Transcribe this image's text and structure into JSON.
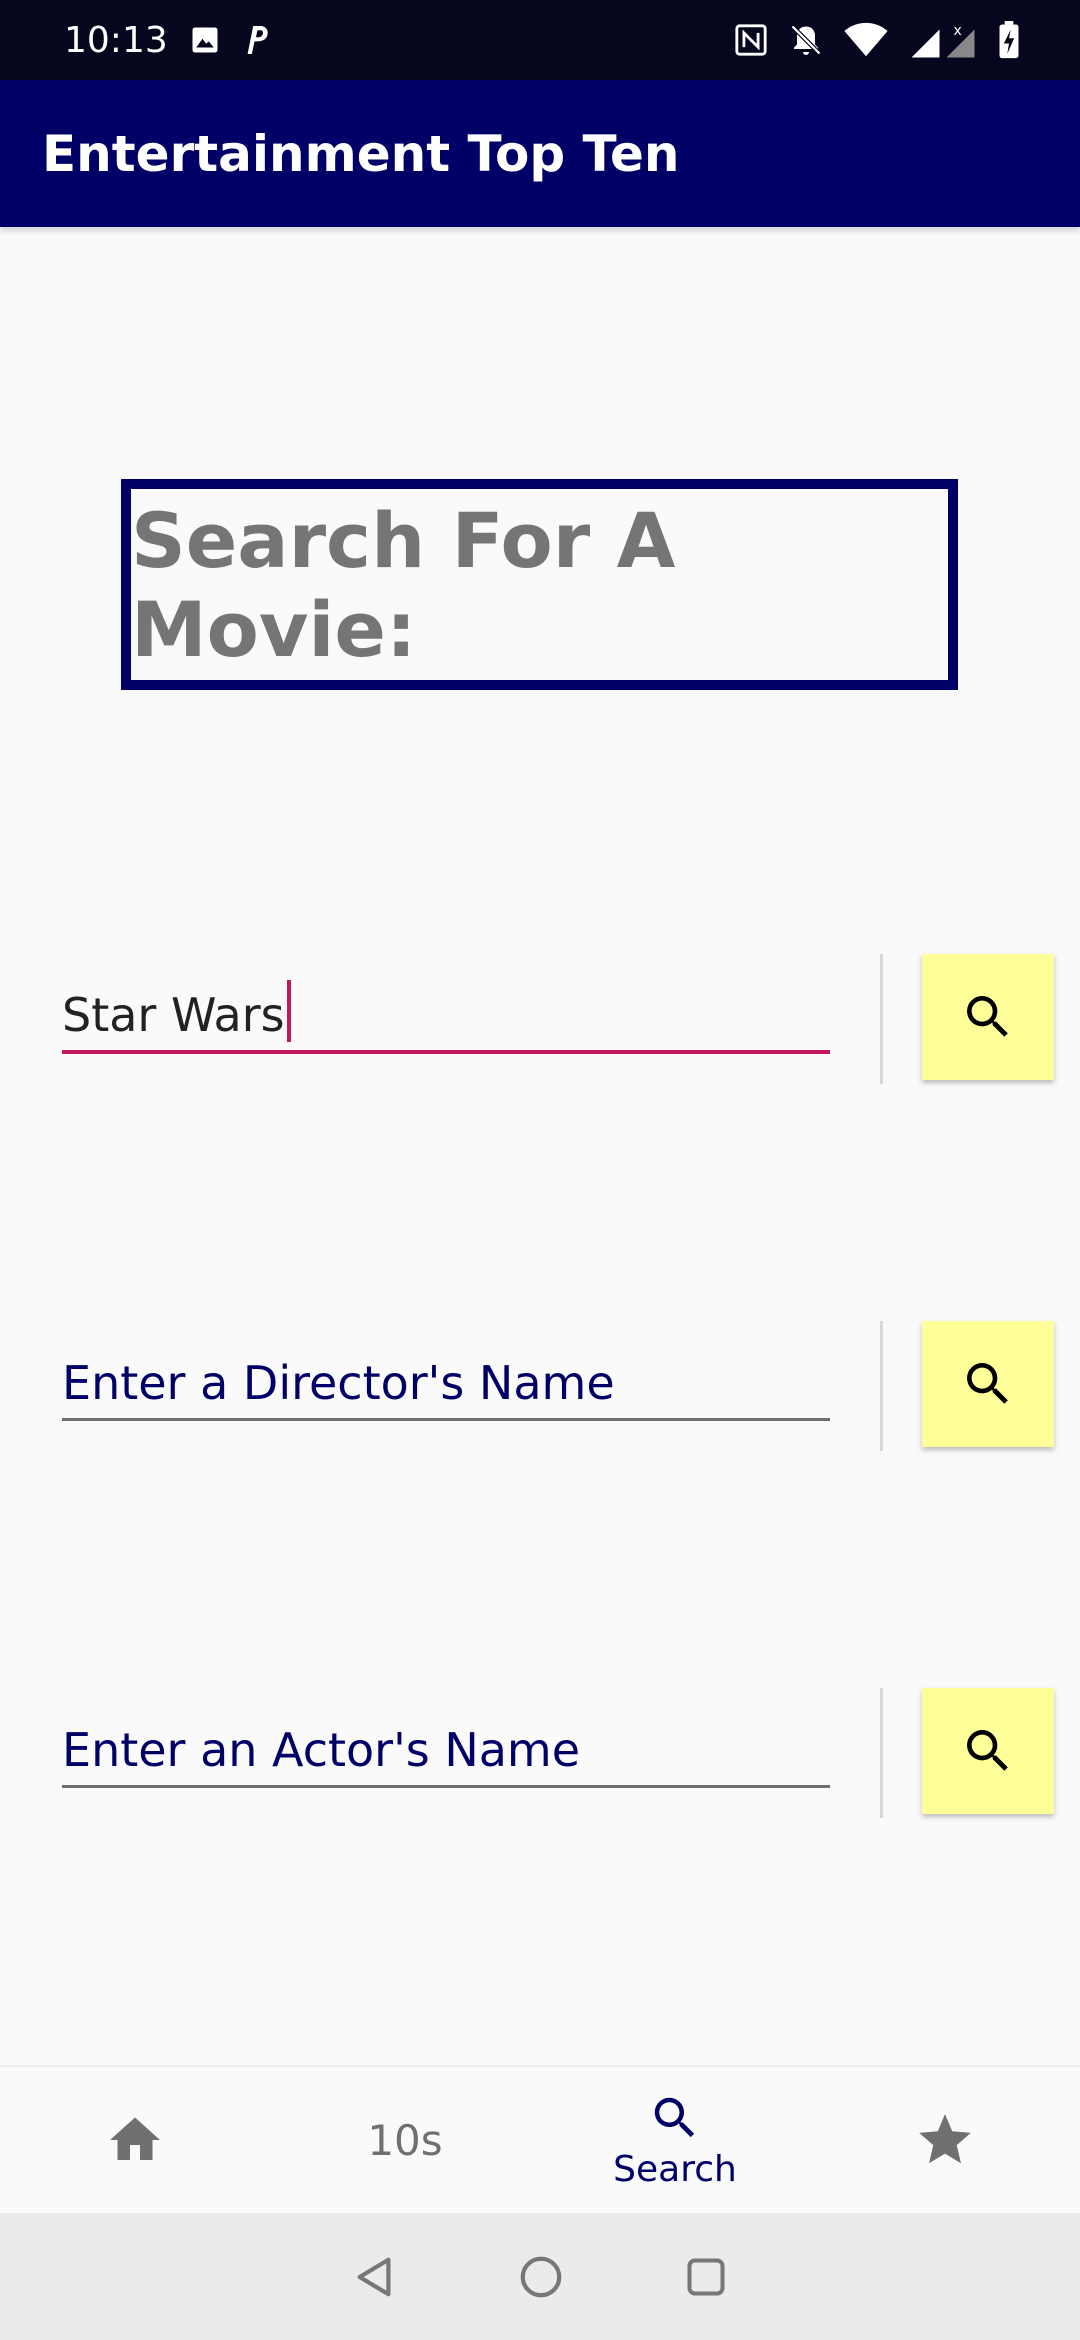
{
  "status_bar": {
    "time": "10:13",
    "icons": [
      "image-icon",
      "parking-p-icon",
      "nfc-icon",
      "muted-bell-icon",
      "wifi-icon",
      "signal-icon",
      "battery-icon"
    ]
  },
  "app_bar": {
    "title": "Entertainment Top Ten"
  },
  "heading": {
    "text": "Search For A Movie:"
  },
  "searches": [
    {
      "value": "Star Wars",
      "placeholder": ""
    },
    {
      "value": "",
      "placeholder": "Enter a Director's Name"
    },
    {
      "value": "",
      "placeholder": "Enter an Actor's Name"
    }
  ],
  "bottom_nav": {
    "items": [
      {
        "icon": "home-icon",
        "label": ""
      },
      {
        "icon": "",
        "label": "10s"
      },
      {
        "icon": "search-icon",
        "label": "Search",
        "selected": true
      },
      {
        "icon": "star-icon",
        "label": ""
      }
    ]
  },
  "colors": {
    "status_bar": "#06061f",
    "app_bar": "#000066",
    "active_underline": "#c2185b",
    "button_bg": "#ffff99",
    "heading_text": "#757575"
  }
}
